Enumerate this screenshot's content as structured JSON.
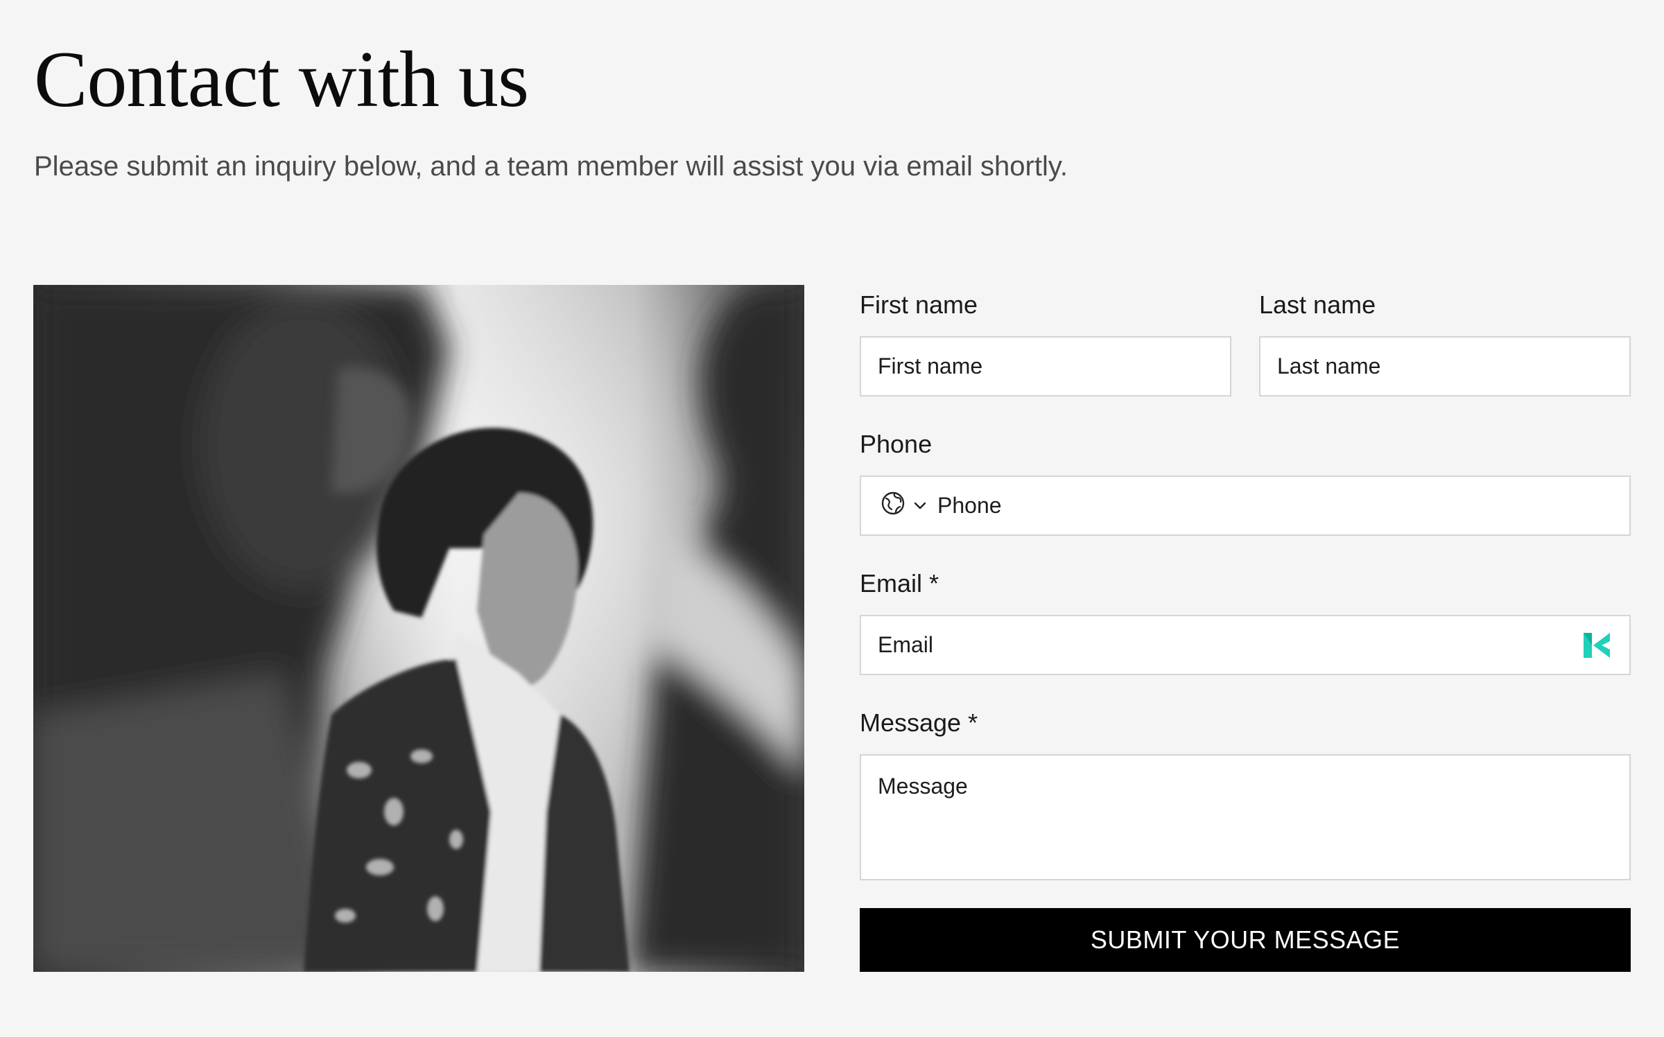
{
  "header": {
    "title": "Contact with us",
    "subtitle": "Please submit an inquiry below, and a team member will assist you via email shortly."
  },
  "form": {
    "first_name": {
      "label": "First name",
      "placeholder": "First name"
    },
    "last_name": {
      "label": "Last name",
      "placeholder": "Last name"
    },
    "phone": {
      "label": "Phone",
      "placeholder": "Phone",
      "country_icon": "globe-icon",
      "dropdown_icon": "chevron-down-icon"
    },
    "email": {
      "label": "Email *",
      "placeholder": "Email",
      "badge_icon": "autofill-k-icon",
      "badge_color": "#1fd1b9"
    },
    "message": {
      "label": "Message *",
      "placeholder": "Message"
    },
    "submit_label": "SUBMIT YOUR MESSAGE"
  },
  "colors": {
    "background": "#f5f5f5",
    "button": "#000000",
    "button_text": "#ffffff",
    "field_border": "#d5d5d5"
  }
}
